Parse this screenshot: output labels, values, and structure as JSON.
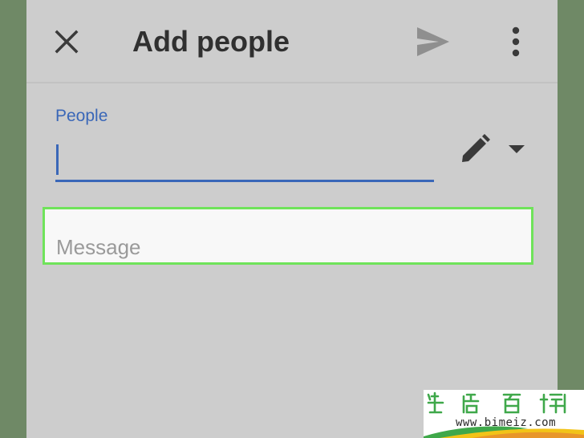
{
  "appbar": {
    "title": "Add people",
    "close_icon": "close-icon",
    "send_icon": "send-icon",
    "more_icon": "more-vert-icon"
  },
  "people": {
    "label": "People",
    "value": "",
    "pencil_icon": "pencil-icon",
    "dropdown_icon": "arrow-drop-down-icon"
  },
  "message": {
    "placeholder": "Message",
    "value": ""
  },
  "watermark": {
    "url": "www.bimeiz.com"
  },
  "colors": {
    "accent": "#3a67b8",
    "highlight": "#6fe35a",
    "background": "#cdcdcd",
    "frame": "#6f8966"
  }
}
